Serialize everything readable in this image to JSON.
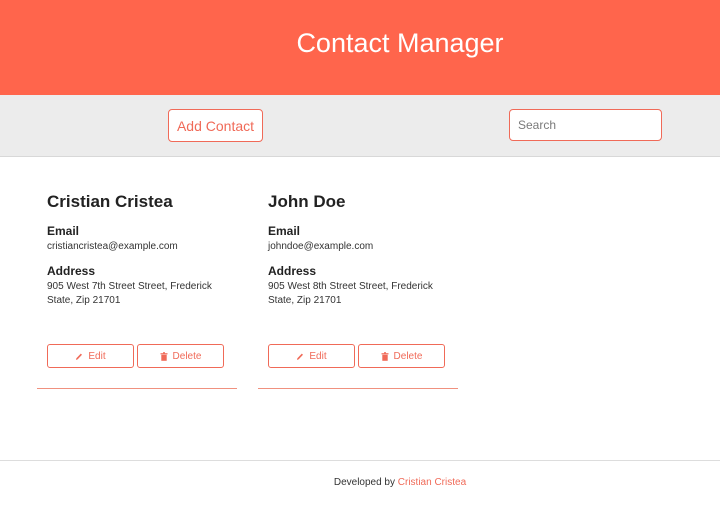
{
  "header": {
    "title": "Contact Manager"
  },
  "toolbar": {
    "add_label": "Add Contact",
    "search_placeholder": "Search"
  },
  "contacts": [
    {
      "name": "Cristian Cristea",
      "email_label": "Email",
      "email": "cristiancristea@example.com",
      "address_label": "Address",
      "address": "905 West 7th Street Street, Frederick State, Zip 21701",
      "edit_label": "Edit",
      "delete_label": "Delete"
    },
    {
      "name": "John Doe",
      "email_label": "Email",
      "email": "johndoe@example.com",
      "address_label": "Address",
      "address": "905 West 8th Street Street, Frederick State, Zip 21701",
      "edit_label": "Edit",
      "delete_label": "Delete"
    }
  ],
  "footer": {
    "prefix": "Developed by",
    "author": "Cristian Cristea"
  },
  "colors": {
    "accent": "#ff654c",
    "toolbar_bg": "#ececec"
  },
  "icons": {
    "edit": "pencil-icon",
    "delete": "trash-icon"
  }
}
